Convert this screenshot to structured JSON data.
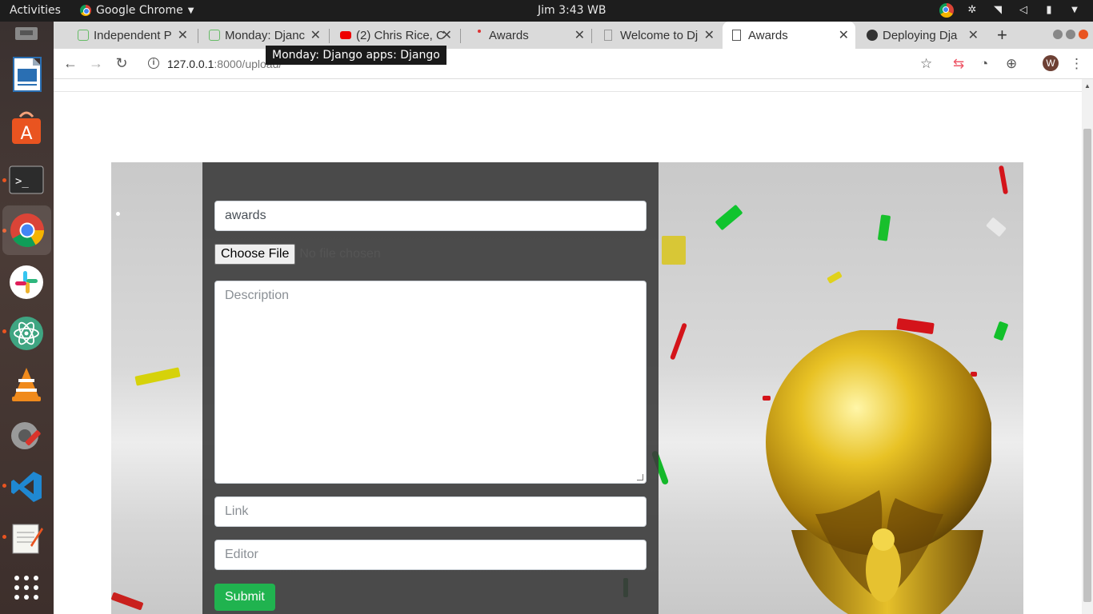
{
  "topbar": {
    "activities": "Activities",
    "app_name": "Google Chrome",
    "clock": "Jim  3:43 WB",
    "tray_icons": [
      "chrome-icon",
      "slack-icon",
      "wifi-icon",
      "volume-icon",
      "battery-icon",
      "chevron-down-icon"
    ]
  },
  "dock": {
    "apps": [
      "files-icon",
      "libreoffice-writer-icon",
      "software-center-icon",
      "terminal-icon",
      "chrome-icon",
      "slack-icon",
      "atom-icon",
      "vlc-icon",
      "settings-icon",
      "vscode-icon",
      "text-editor-icon",
      "app-grid-icon"
    ]
  },
  "tabs": [
    {
      "title": "Independent P",
      "favicon": "green"
    },
    {
      "title": "Monday: Djanc",
      "favicon": "green"
    },
    {
      "title": "(2) Chris Rice, C",
      "favicon": "youtube"
    },
    {
      "title": "Awards",
      "favicon": "red-dot"
    },
    {
      "title": "Welcome to Dj",
      "favicon": "doc"
    },
    {
      "title": "Awards",
      "favicon": "doc",
      "active": true
    },
    {
      "title": "Deploying Dja",
      "favicon": "github"
    }
  ],
  "toolbar": {
    "url_host": "127.0.0.1",
    "url_rest": ":8000/upload/",
    "avatar_letter": "W"
  },
  "tooltip": "Monday: Django apps: Django",
  "form": {
    "title_value": "awards",
    "file_button": "Choose File",
    "file_status": "No file chosen",
    "description_placeholder": "Description",
    "link_placeholder": "Link",
    "editor_placeholder": "Editor",
    "submit_label": "Submit"
  },
  "colors": {
    "submit": "#20b34f",
    "panel": "#3c3c3c",
    "ubuntu_accent": "#e95420"
  }
}
